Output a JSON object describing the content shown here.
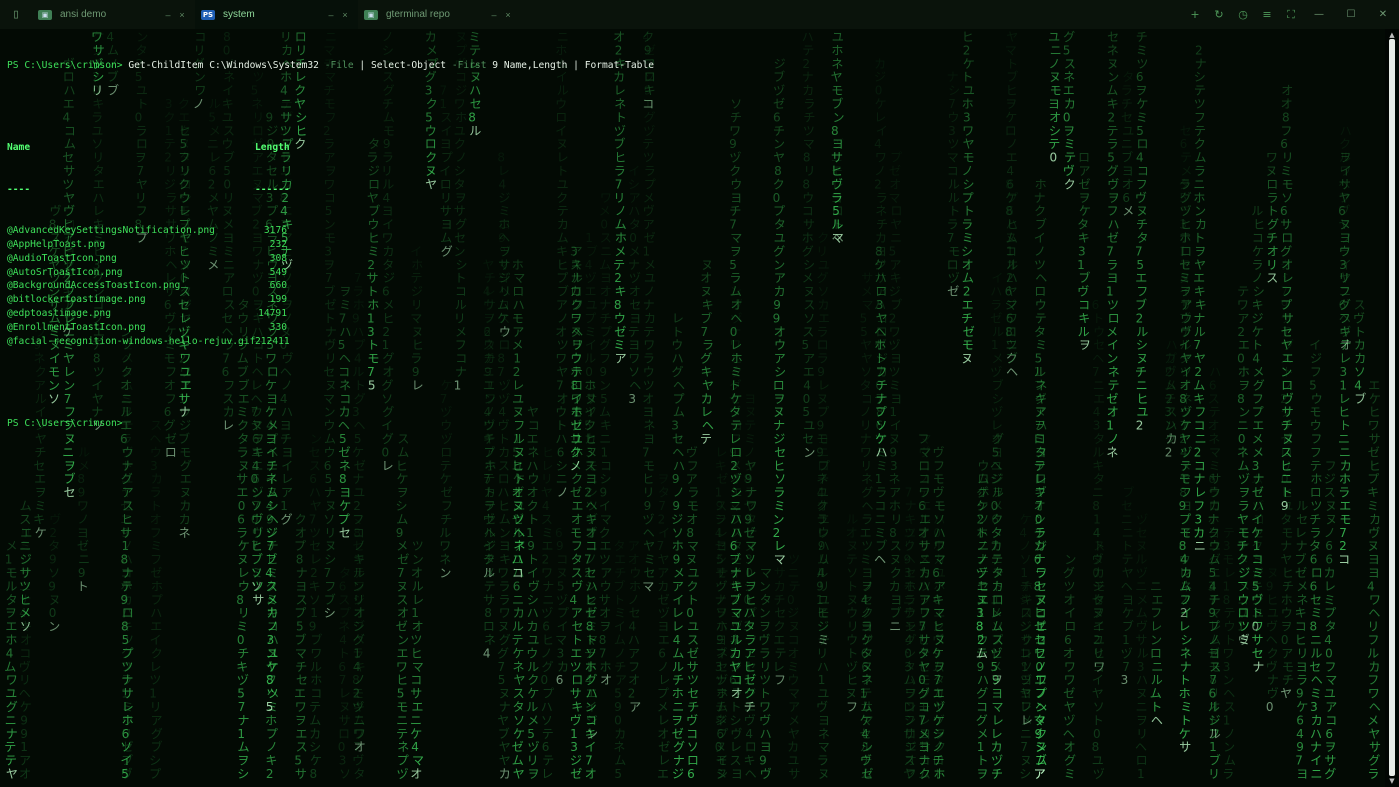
{
  "tabs": [
    {
      "label": "ansi demo",
      "icon": "generic-terminal-icon",
      "active": false
    },
    {
      "label": "system",
      "icon": "powershell-icon",
      "active": true
    },
    {
      "label": "gterminal repo",
      "icon": "generic-terminal-icon",
      "active": false
    }
  ],
  "tab_icon_text": {
    "ps": "PS",
    "gen": "▣"
  },
  "glyphs": {
    "minimize": "–",
    "close": "×",
    "sidebar": "▯",
    "new_tab": "+",
    "reload": "↻",
    "history": "◷",
    "settings": "≡",
    "fullscreen": "⛶",
    "win_min": "—",
    "win_max": "☐",
    "win_close": "✕",
    "scroll_up": "▲",
    "scroll_down": "▼"
  },
  "terminal": {
    "prompt1": "PS C:\\Users\\crimson>",
    "cmd1": "Get-ChildItem",
    "arg1": "C:\\Windows\\System32",
    "param1": "-File",
    "pipe1": "|",
    "cmd2": "Select-Object",
    "param2": "-First",
    "arg2": "9 Name,Length",
    "pipe2": "|",
    "cmd3": "Format-Table",
    "headers": {
      "name": "Name",
      "length": "Length"
    },
    "separators": {
      "name": "----",
      "length": "------"
    },
    "rows": [
      {
        "name": "@AdvancedKeySettingsNotification.png",
        "length": "3176"
      },
      {
        "name": "@AppHelpToast.png",
        "length": "232"
      },
      {
        "name": "@AudioToastIcon.png",
        "length": "308"
      },
      {
        "name": "@AutoSrToastIcon.png",
        "length": "549"
      },
      {
        "name": "@BackgroundAccessToastIcon.png",
        "length": "660"
      },
      {
        "name": "@bitlockertoastimage.png",
        "length": "199"
      },
      {
        "name": "@edptoastimage.png",
        "length": "14791"
      },
      {
        "name": "@EnrollmentToastIcon.png",
        "length": "330"
      },
      {
        "name": "@facial-recognition-windows-hello-rejuv.gif",
        "length": "212411"
      }
    ],
    "prompt2": "PS C:\\Users\\crimson>"
  },
  "colors": {
    "background": "#030a04",
    "rain_bright": "#3fd35c",
    "rain_dim": "#1e6a2e",
    "prompt": "#3ee05a",
    "command": "#e6f1e6"
  }
}
